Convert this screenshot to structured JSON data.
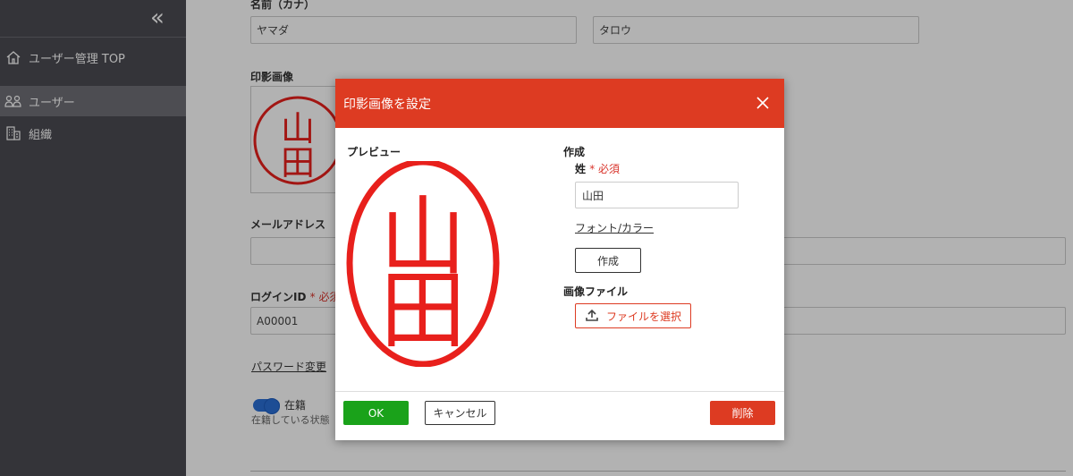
{
  "sidebar": {
    "items": [
      {
        "label": "ユーザー管理 TOP",
        "icon": "home-icon"
      },
      {
        "label": "ユーザー",
        "icon": "users-icon",
        "active": true
      },
      {
        "label": "組織",
        "icon": "organization-icon"
      }
    ]
  },
  "form": {
    "kana_label": "名前（カナ）",
    "kana_last": "ヤマダ",
    "kana_first": "タロウ",
    "stamp_label": "印影画像",
    "email_label": "メールアドレス",
    "email_value": "",
    "login_label": "ログインID",
    "login_required": "* 必須",
    "login_value": "A00001",
    "password_link": "パスワード変更",
    "status_label": "在籍",
    "status_hint": "在籍している状態",
    "status_on": true
  },
  "stamp": {
    "text_top": "山",
    "text_bottom": "田",
    "color": "#e8201c"
  },
  "modal": {
    "title": "印影画像を設定",
    "preview_label": "プレビュー",
    "create_section": "作成",
    "surname_label": "姓",
    "surname_required": "* 必須",
    "surname_value": "山田",
    "font_color_link": "フォント/カラー",
    "create_button": "作成",
    "image_file_section": "画像ファイル",
    "file_select_button": "ファイルを選択",
    "ok_button": "OK",
    "cancel_button": "キャンセル",
    "delete_button": "削除"
  },
  "colors": {
    "header_red": "#dd3b22",
    "ok_green": "#1aa21a",
    "sidebar_bg": "#4b4b52"
  }
}
